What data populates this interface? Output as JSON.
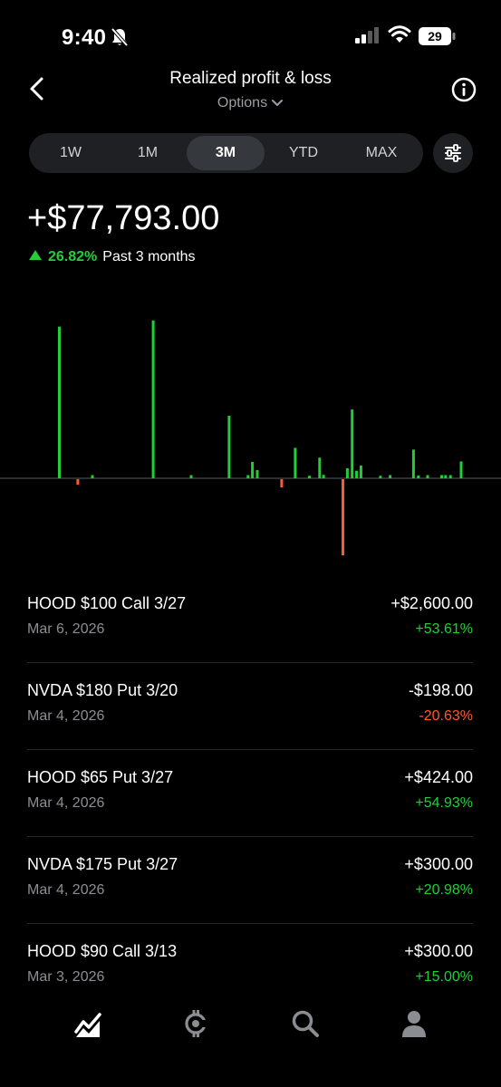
{
  "status_bar": {
    "time": "9:40",
    "battery": "29"
  },
  "header": {
    "title": "Realized profit & loss",
    "subtitle": "Options"
  },
  "range_tabs": [
    "1W",
    "1M",
    "3M",
    "YTD",
    "MAX"
  ],
  "active_range": "3M",
  "summary": {
    "amount": "+$77,793.00",
    "percent": "26.82%",
    "period": "Past 3 months"
  },
  "colors": {
    "gain": "#21ce38",
    "loss": "#ff5a2c",
    "background": "#000000"
  },
  "chart_data": {
    "type": "bar",
    "unit": "USD",
    "x_range": [
      0,
      100
    ],
    "ylim": [
      -4800,
      10200
    ],
    "baseline": 0,
    "points": [
      {
        "x": 10.7,
        "value": 9700
      },
      {
        "x": 14.5,
        "value": -340
      },
      {
        "x": 17.5,
        "value": 200
      },
      {
        "x": 30.0,
        "value": 10100
      },
      {
        "x": 37.8,
        "value": 200
      },
      {
        "x": 45.6,
        "value": 4000
      },
      {
        "x": 49.5,
        "value": 200
      },
      {
        "x": 50.4,
        "value": 1050
      },
      {
        "x": 51.4,
        "value": 520
      },
      {
        "x": 56.4,
        "value": -520
      },
      {
        "x": 59.2,
        "value": 1950
      },
      {
        "x": 62.1,
        "value": 160
      },
      {
        "x": 64.2,
        "value": 1320
      },
      {
        "x": 65.0,
        "value": 220
      },
      {
        "x": 69.0,
        "value": -4800
      },
      {
        "x": 69.9,
        "value": 640
      },
      {
        "x": 70.9,
        "value": 4400
      },
      {
        "x": 71.8,
        "value": 480
      },
      {
        "x": 72.7,
        "value": 820
      },
      {
        "x": 76.7,
        "value": 160
      },
      {
        "x": 78.7,
        "value": 200
      },
      {
        "x": 83.5,
        "value": 1840
      },
      {
        "x": 84.5,
        "value": 180
      },
      {
        "x": 86.4,
        "value": 200
      },
      {
        "x": 89.3,
        "value": 200
      },
      {
        "x": 90.1,
        "value": 200
      },
      {
        "x": 91.1,
        "value": 200
      },
      {
        "x": 93.3,
        "value": 1080
      }
    ]
  },
  "trades": [
    {
      "name": "HOOD $100 Call 3/27",
      "date": "Mar 6, 2026",
      "value": "+$2,600.00",
      "percent": "+53.61%",
      "direction": "gain"
    },
    {
      "name": "NVDA $180 Put 3/20",
      "date": "Mar 4, 2026",
      "value": "-$198.00",
      "percent": "-20.63%",
      "direction": "loss"
    },
    {
      "name": "HOOD $65 Put 3/27",
      "date": "Mar 4, 2026",
      "value": "+$424.00",
      "percent": "+54.93%",
      "direction": "gain"
    },
    {
      "name": "NVDA $175 Put 3/27",
      "date": "Mar 4, 2026",
      "value": "+$300.00",
      "percent": "+20.98%",
      "direction": "gain"
    },
    {
      "name": "HOOD $90 Call 3/13",
      "date": "Mar 3, 2026",
      "value": "+$300.00",
      "percent": "+15.00%",
      "direction": "gain"
    }
  ],
  "nav": [
    {
      "icon": "chart-icon",
      "active": true
    },
    {
      "icon": "crypto-icon",
      "active": false
    },
    {
      "icon": "search-icon",
      "active": false
    },
    {
      "icon": "account-icon",
      "active": false
    }
  ]
}
